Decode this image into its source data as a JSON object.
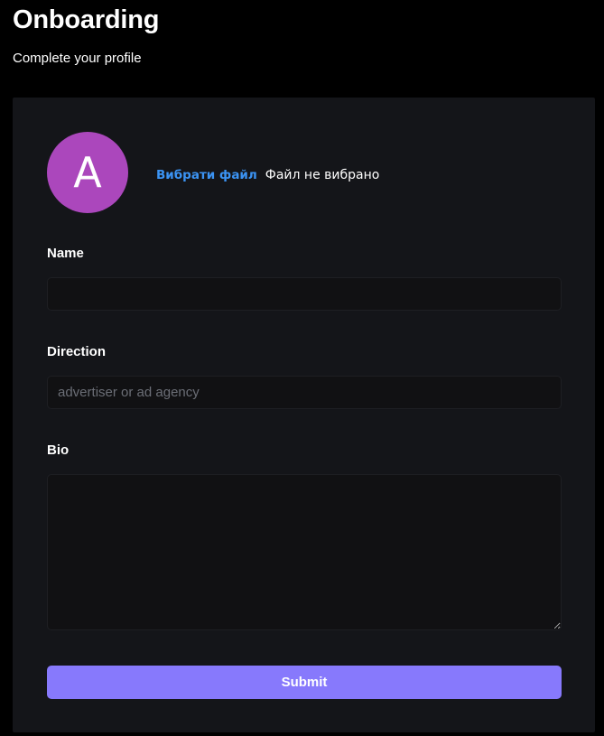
{
  "header": {
    "title": "Onboarding",
    "subtitle": "Complete your profile"
  },
  "avatar": {
    "initial": "A",
    "color": "#ab47bc"
  },
  "file_picker": {
    "button_label": "Вибрати файл",
    "status": "Файл не вибрано"
  },
  "form": {
    "name": {
      "label": "Name",
      "value": "",
      "placeholder": ""
    },
    "direction": {
      "label": "Direction",
      "value": "",
      "placeholder": "advertiser or ad agency"
    },
    "bio": {
      "label": "Bio",
      "value": "",
      "placeholder": ""
    },
    "submit_label": "Submit"
  },
  "colors": {
    "background": "#000000",
    "card": "#141519",
    "input": "#111113",
    "accent": "#8779fc",
    "link": "#3b93f3"
  }
}
